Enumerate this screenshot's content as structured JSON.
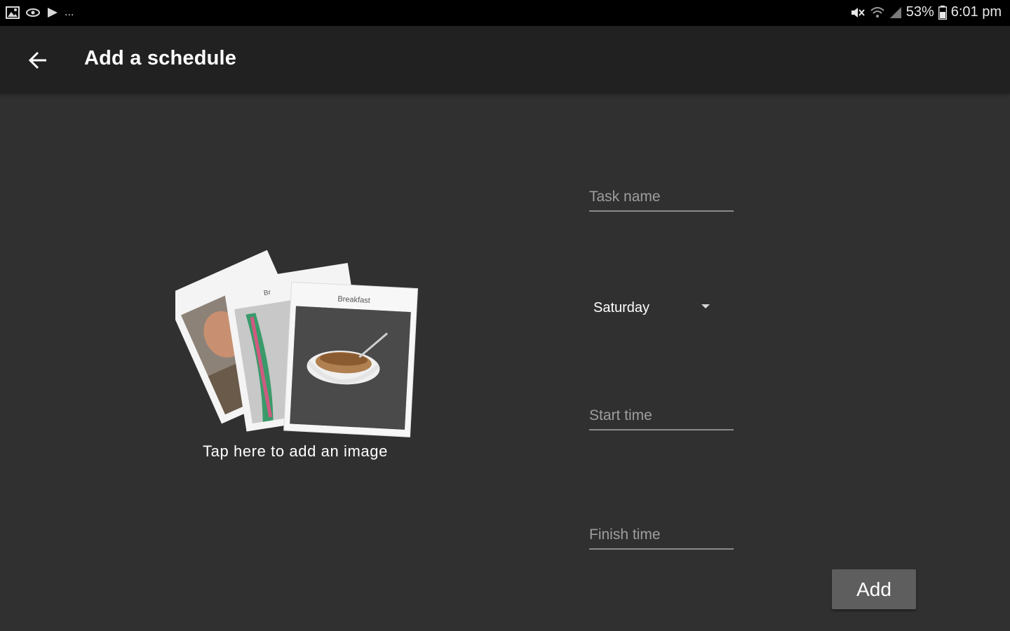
{
  "status_bar": {
    "left_icons": [
      "gallery-icon",
      "eye-icon",
      "play-icon"
    ],
    "overflow": "...",
    "right_icons": [
      "mute-icon",
      "wifi-icon",
      "signal-icon"
    ],
    "battery": "53%",
    "time": "6:01 pm"
  },
  "app_bar": {
    "back_icon": "arrow-left-icon",
    "title": "Add a schedule"
  },
  "image_picker": {
    "caption": "Tap here to add an image",
    "photos": [
      {
        "label": ""
      },
      {
        "label": "Br"
      },
      {
        "label": "Breakfast"
      }
    ]
  },
  "form": {
    "task_name": {
      "value": "",
      "placeholder": "Task name"
    },
    "day": {
      "selected": "Saturday"
    },
    "start_time": {
      "value": "",
      "placeholder": "Start time"
    },
    "finish_time": {
      "value": "",
      "placeholder": "Finish time"
    },
    "add_label": "Add"
  },
  "colors": {
    "background": "#303030",
    "app_bar": "#212121",
    "status_bar": "#000000",
    "button": "#5e5e5e"
  }
}
